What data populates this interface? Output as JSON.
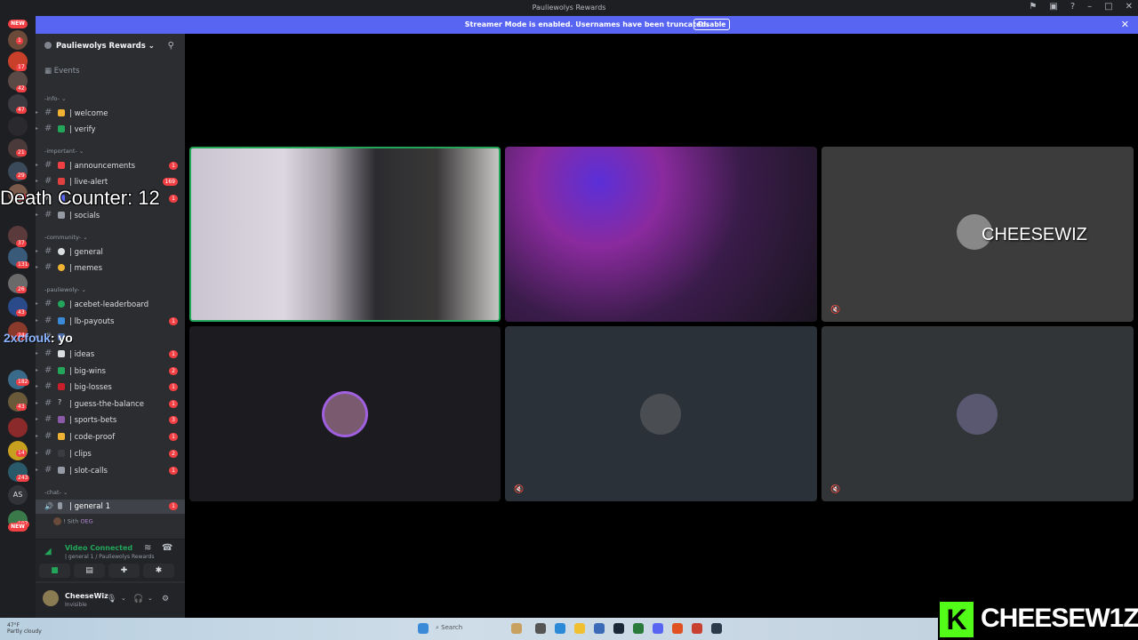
{
  "window": {
    "title": "Pauliewolys Rewards"
  },
  "banner": {
    "message": "Streamer Mode is enabled. Usernames have been truncated.",
    "button": "Disable"
  },
  "servers": {
    "new_label": "NEW",
    "badges": [
      "1",
      "17",
      "42",
      "47",
      "21",
      "29",
      "30",
      "62",
      "37",
      "131",
      "26",
      "43",
      "24",
      "1",
      "182",
      "43",
      "14",
      "243",
      "187"
    ],
    "as_label": "AS"
  },
  "sidebar": {
    "server_name": "Pauliewolys Rewards",
    "events_label": "Events",
    "categories": {
      "info": "-info-",
      "important": "-important-",
      "community": "-community-",
      "pauliewoly": "-pauliewoly-",
      "chat": "-chat-"
    },
    "channels": [
      {
        "name": "| welcome",
        "count": ""
      },
      {
        "name": "| verify",
        "count": ""
      },
      {
        "name": "| announcements",
        "count": "1"
      },
      {
        "name": "| live-alert",
        "count": "169"
      },
      {
        "name": "",
        "count": "1"
      },
      {
        "name": "| socials",
        "count": ""
      },
      {
        "name": "| general",
        "count": ""
      },
      {
        "name": "| memes",
        "count": ""
      },
      {
        "name": "| acebet-leaderboard",
        "count": ""
      },
      {
        "name": "| lb-payouts",
        "count": "1"
      },
      {
        "name": "",
        "count": ""
      },
      {
        "name": "| ideas",
        "count": "1"
      },
      {
        "name": "| big-wins",
        "count": "2"
      },
      {
        "name": "| big-losses",
        "count": "1"
      },
      {
        "name": "| guess-the-balance",
        "count": "1"
      },
      {
        "name": "| sports-bets",
        "count": "3"
      },
      {
        "name": "| code-proof",
        "count": "1"
      },
      {
        "name": "| clips",
        "count": "2"
      },
      {
        "name": "| slot-calls",
        "count": "1"
      }
    ],
    "voice_channel": {
      "name": "| general 1",
      "count": "1"
    },
    "voice_user": "! Sith",
    "voice_user_tag": "OEG",
    "voice_panel": {
      "status": "Video Connected",
      "subtitle": "| general 1 / Pauliewolys Rewards"
    },
    "user": {
      "name": "CheeseWiz",
      "status": "Invisible"
    }
  },
  "call": {
    "tiles": [
      {
        "kind": "video",
        "speaking": true
      },
      {
        "kind": "video",
        "speaking": false
      },
      {
        "kind": "name",
        "name": "CHEESEWIZ",
        "muted": true
      },
      {
        "kind": "avatar",
        "avatar_color": "#7a5a6e",
        "ring": true
      },
      {
        "kind": "avatar",
        "avatar_color": "#4a4d52",
        "muted": true
      },
      {
        "kind": "avatar",
        "avatar_color": "#5a5870",
        "muted": true
      }
    ]
  },
  "overlays": {
    "death_counter": "Death Counter: 12",
    "chat_user": "2xcfouk",
    "chat_sep": ":",
    "chat_message": " yo",
    "kick_logo": "K",
    "kick_name": "CHEESEW1Z"
  },
  "taskbar": {
    "weather_temp": "47°F",
    "weather_desc": "Partly cloudy",
    "search": "Search"
  }
}
